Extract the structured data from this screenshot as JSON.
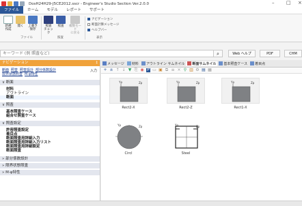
{
  "window": {
    "title": "DosH24H29-J5CE2012.sscr - Engineer's Studio Section Ver.2.0.0",
    "controls": [
      "–",
      "□",
      "×"
    ]
  },
  "ribbon_tabs": [
    "ファイル",
    "ホーム",
    "モデル",
    "レポート",
    "サポート"
  ],
  "ribbon": {
    "buttons": [
      {
        "label": "新規\n作成"
      },
      {
        "label": "開く"
      },
      {
        "label": "上書き\n保存"
      },
      {
        "label": "照査\nチェック"
      },
      {
        "label": "照査"
      },
      {
        "label": "複数モード\nに戻る"
      }
    ],
    "checks": [
      {
        "label": "ナビゲーション",
        "checked": true
      },
      {
        "label": "断面計算メッセージ",
        "checked": false
      },
      {
        "label": "ヘルプバー",
        "checked": true
      }
    ],
    "groups": [
      "ファイル",
      "照査",
      "表示"
    ]
  },
  "search": {
    "placeholder": "キーワード (例 照査など)",
    "web_help": "Web ヘルプ",
    "pdf": "PDF",
    "chm": "CHM"
  },
  "nav": {
    "title": "ナビゲーション",
    "links": [
      "断面",
      "照査",
      "照査設計",
      "部分係数設計",
      "限界状態照査",
      "M-φ特性"
    ],
    "side_label": "入力",
    "sections": [
      {
        "title": "断面",
        "items": [
          "材料",
          "アウトライン",
          "断面"
        ]
      },
      {
        "title": "照査",
        "items": [
          "基本照査ケース",
          "組合せ照査ケース"
        ]
      },
      {
        "title": "照査設定",
        "items": [
          "許容照査設定",
          "着目点",
          "断面照査用詳細入力",
          "断面照査用詳細入力リスト",
          "断面照査用詳細設定",
          "断面照査"
        ]
      },
      {
        "title": "部分係数設計",
        "items": []
      },
      {
        "title": "限界状態照査",
        "items": []
      },
      {
        "title": "M-φ特性",
        "items": []
      }
    ]
  },
  "doc_tabs": [
    "メッセージ",
    "材料",
    "アウトライン サムネイル",
    "断面サムネイル",
    "基本照査ケース",
    "着目点"
  ],
  "shapes": [
    {
      "name": "Rect2-X"
    },
    {
      "name": "Rect2-Z"
    },
    {
      "name": "Rect1-X"
    },
    {
      "name": "Circl"
    },
    {
      "name": "Steel"
    }
  ],
  "colors": {
    "brand": "#2b5797",
    "nav_header": "#f0a23b",
    "section_bg": "#e3e6ee",
    "shape_fill": "#7f8184"
  }
}
